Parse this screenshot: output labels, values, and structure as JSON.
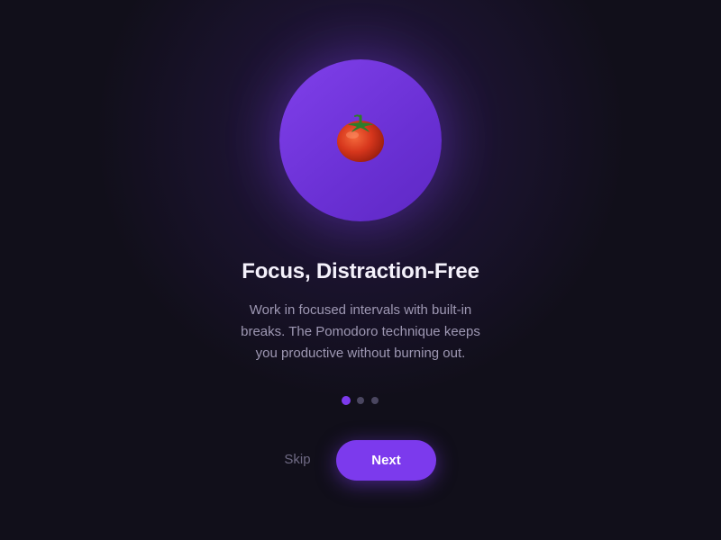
{
  "onboarding": {
    "hero": {
      "icon": "tomato-icon",
      "circle_color": "#7c3aed"
    },
    "title": "Focus, Distraction-Free",
    "description_lines": [
      "Work in focused intervals with built-in",
      "breaks. The Pomodoro technique keeps",
      "you productive without burning out."
    ],
    "pagination": {
      "total": 3,
      "current": 1
    },
    "actions": {
      "skip_label": "Skip",
      "next_label": "Next"
    },
    "colors": {
      "background": "#110f1a",
      "accent": "#7c3aed",
      "title": "#f4f1fb",
      "body_text": "#9e98b3",
      "muted": "#6f6a84"
    }
  }
}
